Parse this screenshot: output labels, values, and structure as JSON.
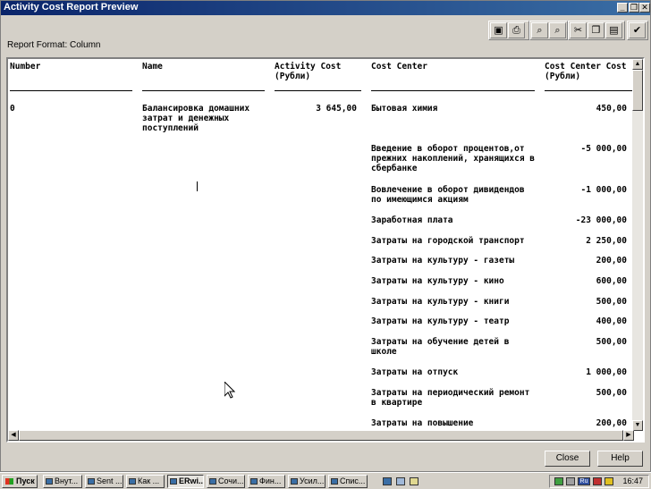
{
  "window": {
    "title": "Activity Cost Report Preview"
  },
  "title_buttons": {
    "minimize": "_",
    "maximize": "❐",
    "close": "✕"
  },
  "toolbar": {
    "tools": [
      "save-icon",
      "print-icon",
      "find-icon",
      "find-next-icon",
      "cut-icon",
      "copy-icon",
      "paste-icon",
      "check-icon"
    ]
  },
  "report_format": "Report Format: Column",
  "report": {
    "headers": {
      "number": "Number",
      "name": "Name",
      "activity_cost": "Activity Cost\n(Рубли)",
      "cost_center": "Cost Center",
      "cost_center_cost": "Cost Center Cost\n(Рубли)"
    },
    "row": {
      "number": "0",
      "name": "Балансировка домашних\nзатрат и денежных\nпоступлений",
      "activity_cost": "3 645,00"
    },
    "cost_centers": [
      {
        "name": "Бытовая химия",
        "cost": "450,00"
      },
      {
        "name": "Введение в оборот процентов,от\nпрежних накоплений, хранящихся в\nсбербанке",
        "cost": "-5 000,00"
      },
      {
        "name": "Вовлечение в оборот дивидендов\nпо имеющимся акциям",
        "cost": "-1 000,00"
      },
      {
        "name": "Заработная плата",
        "cost": "-23 000,00"
      },
      {
        "name": "Затраты на городской транспорт",
        "cost": "2 250,00"
      },
      {
        "name": "Затраты на культуру - газеты",
        "cost": "200,00"
      },
      {
        "name": "Затраты на культуру - кино",
        "cost": "600,00"
      },
      {
        "name": "Затраты на культуру - книги",
        "cost": "500,00"
      },
      {
        "name": "Затраты на культуру - театр",
        "cost": "400,00"
      },
      {
        "name": "Затраты на обучение детей в\nшколе",
        "cost": "500,00"
      },
      {
        "name": "Затраты на отпуск",
        "cost": "1 000,00"
      },
      {
        "name": "Затраты на периодический ремонт\nв квартире",
        "cost": "500,00"
      },
      {
        "name": "Затраты на повышение",
        "cost": "200,00"
      }
    ]
  },
  "buttons": {
    "close": "Close",
    "help": "Help"
  },
  "taskbar": {
    "start": "Пуск",
    "tasks": [
      {
        "label": "Внут...",
        "active": false
      },
      {
        "label": "Sent ...",
        "active": false
      },
      {
        "label": "Как ...",
        "active": false
      },
      {
        "label": "ERwi...",
        "active": true
      },
      {
        "label": "Сочи...",
        "active": false
      },
      {
        "label": "Фин...",
        "active": false
      },
      {
        "label": "Усил...",
        "active": false
      },
      {
        "label": "Спис...",
        "active": false
      }
    ],
    "tray_lang": "Ru",
    "clock": "16:47"
  }
}
